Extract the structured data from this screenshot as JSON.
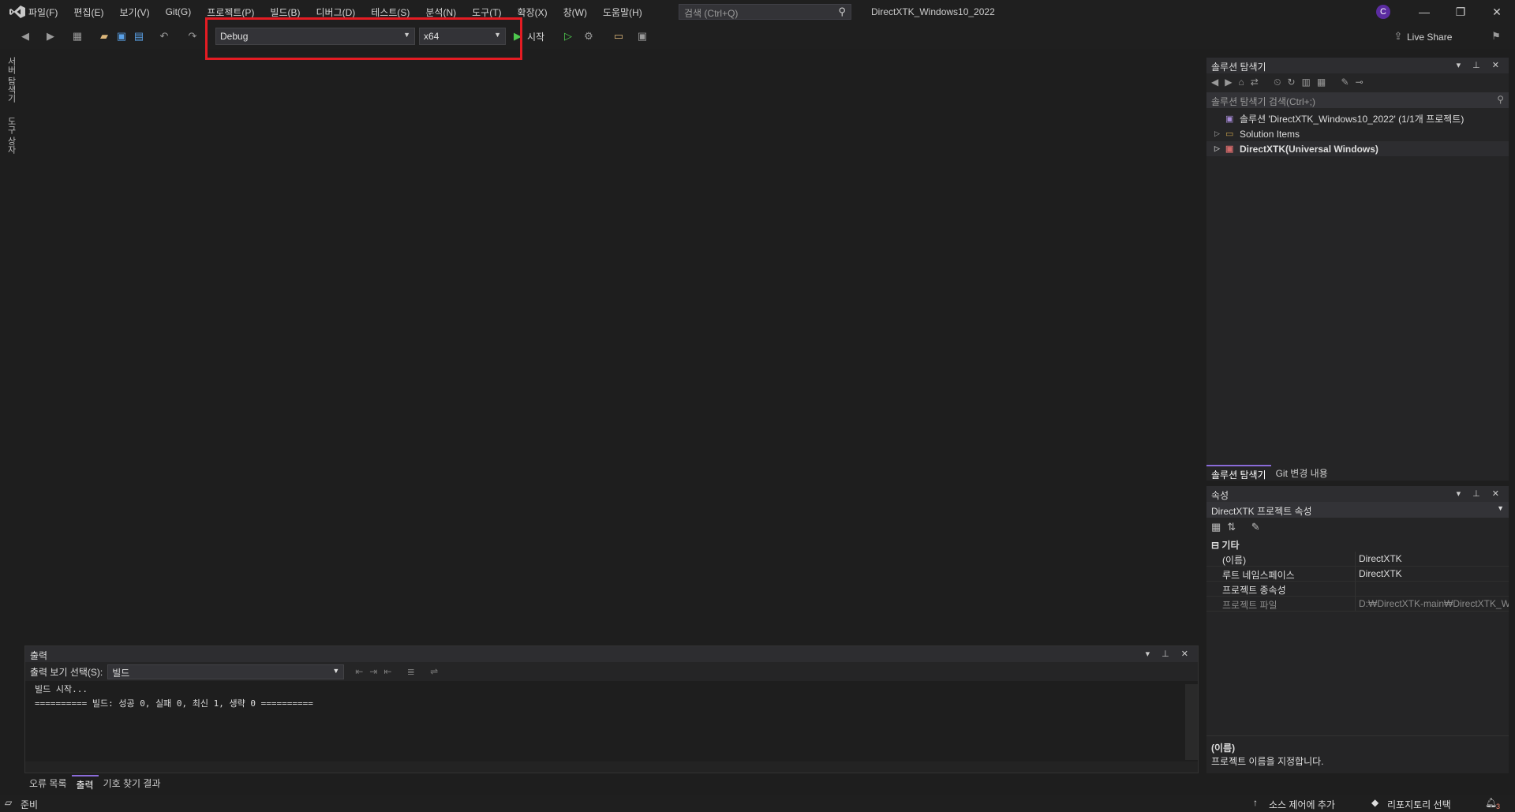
{
  "menu": [
    "파일(F)",
    "편집(E)",
    "보기(V)",
    "Git(G)",
    "프로젝트(P)",
    "빌드(B)",
    "디버그(D)",
    "테스트(S)",
    "분석(N)",
    "도구(T)",
    "확장(X)",
    "창(W)",
    "도움말(H)"
  ],
  "search": {
    "placeholder": "검색 (Ctrl+Q)"
  },
  "window_title": "DirectXTK_Windows10_2022",
  "user_initial": "C",
  "toolbar": {
    "configuration": "Debug",
    "platform": "x64",
    "start_label": "시작",
    "live_share": "Live Share"
  },
  "left_tabs": [
    "서버 탐색기",
    "도구 상자"
  ],
  "solution_explorer": {
    "title": "솔루션 탐색기",
    "search_placeholder": "솔루션 탐색기 검색(Ctrl+;)",
    "tree": [
      {
        "label": "솔루션 'DirectXTK_Windows10_2022' (1/1개 프로젝트)"
      },
      {
        "label": "Solution Items"
      },
      {
        "label": "DirectXTK(Universal Windows)"
      }
    ],
    "tabs": [
      "솔루션 탐색기",
      "Git 변경 내용"
    ]
  },
  "properties": {
    "title": "속성",
    "object": "DirectXTK  프로젝트 속성",
    "category": "기타",
    "rows": [
      {
        "key": "(이름)",
        "value": "DirectXTK"
      },
      {
        "key": "루트 네임스페이스",
        "value": "DirectXTK"
      },
      {
        "key": "프로젝트 종속성",
        "value": ""
      },
      {
        "key": "프로젝트 파일",
        "value": "D:₩DirectXTK-main₩DirectXTK_Win"
      }
    ],
    "desc_title": "(이름)",
    "desc_text": "프로젝트 이름을 지정합니다."
  },
  "output": {
    "title": "출력",
    "show_from_label": "출력 보기 선택(S):",
    "show_from_value": "빌드",
    "lines": [
      "빌드 시작...",
      "========== 빌드: 성공 0, 실패 0, 최신 1, 생략 0 =========="
    ],
    "tabs": [
      "오류 목록",
      "출력",
      "기호 찾기 결과"
    ]
  },
  "statusbar": {
    "ready": "준비",
    "source_control": "소스 제어에 추가",
    "repo": "리포지토리 선택",
    "notifications": "3"
  }
}
